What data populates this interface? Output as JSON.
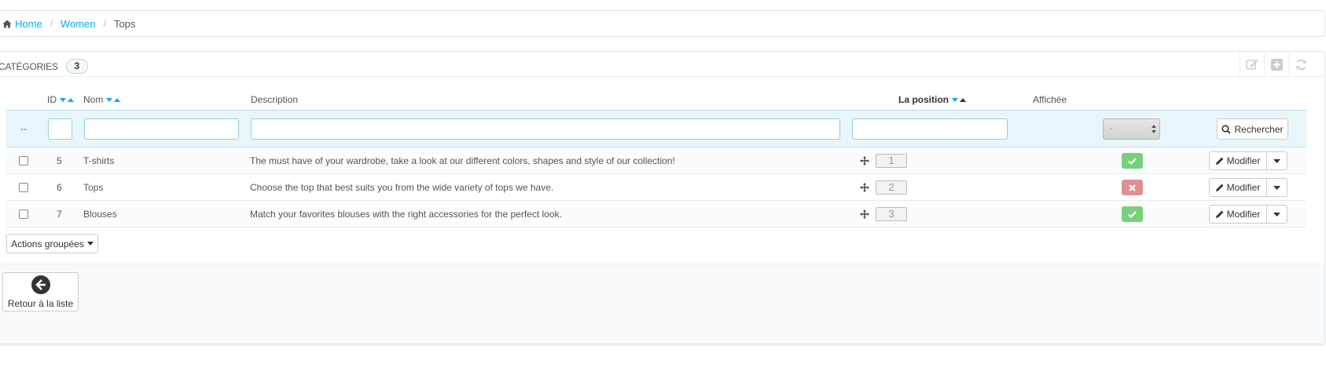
{
  "breadcrumb": [
    {
      "label": "Home",
      "icon": "home-icon"
    },
    {
      "label": "Women"
    },
    {
      "label": "Tops"
    }
  ],
  "panel": {
    "title": "CATÉGORIES",
    "count": "3",
    "tools": [
      "edit-icon",
      "add-icon",
      "refresh-icon"
    ]
  },
  "table": {
    "headers": {
      "id": "ID",
      "name": "Nom",
      "description": "Description",
      "position": "La position",
      "displayed": "Affichée"
    },
    "filters": {
      "dash": "--",
      "displayed_value": "-",
      "search_label": "Rechercher"
    },
    "rows": [
      {
        "id": "5",
        "name": "T-shirts",
        "description": "The must have of your wardrobe, take a look at our different colors, shapes and style of our collection!",
        "position": "1",
        "displayed": true
      },
      {
        "id": "6",
        "name": "Tops",
        "description": "Choose the top that best suits you from the wide variety of tops we have.",
        "position": "2",
        "displayed": false
      },
      {
        "id": "7",
        "name": "Blouses",
        "description": "Match your favorites blouses with the right accessories for the perfect look.",
        "position": "3",
        "displayed": true
      }
    ],
    "edit_label": "Modifier"
  },
  "bulk_actions_label": "Actions groupées",
  "back_label": "Retour à la liste",
  "colors": {
    "link": "#00aff0",
    "status_yes": "#78d07d",
    "status_no": "#e08f95",
    "sort_arrow": "#00aff0"
  }
}
